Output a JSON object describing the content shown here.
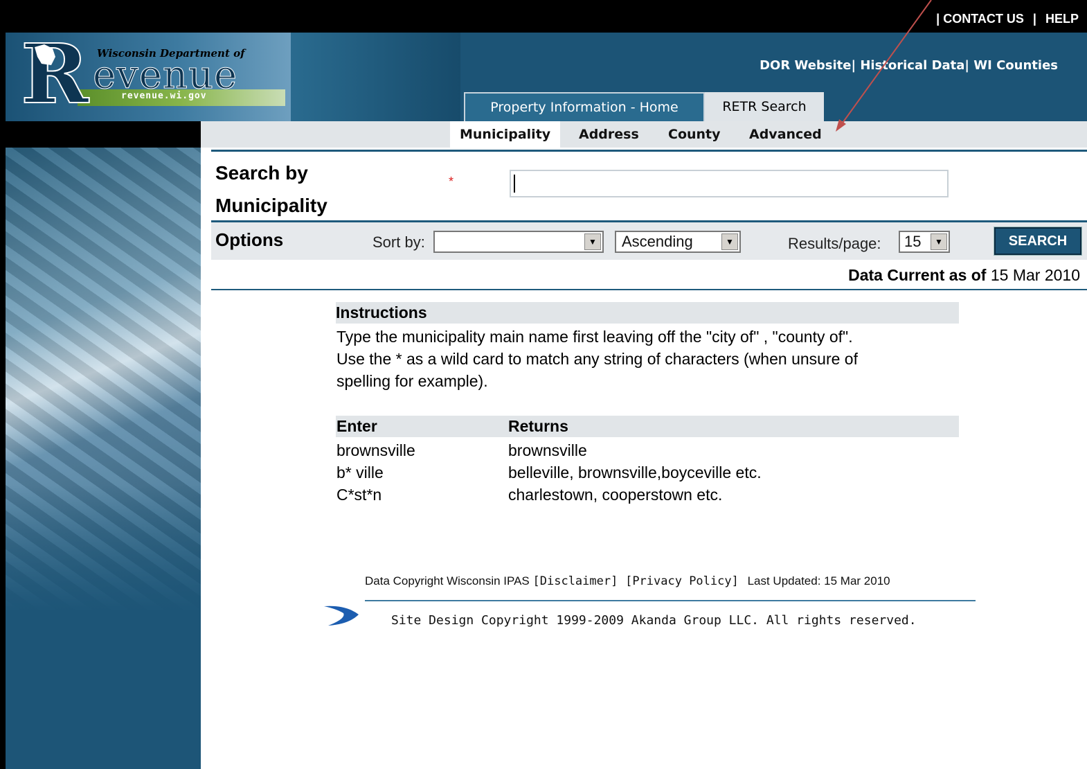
{
  "top_links": {
    "sep1": "|",
    "contact": "CONTACT US",
    "sep2": "|",
    "help": "HELP"
  },
  "logo": {
    "dept": "Wisconsin Department of",
    "letter": "R",
    "word": "evenue",
    "url": "revenue.wi.gov"
  },
  "header_links": {
    "dor": "DOR Website|",
    "historical": "Historical Data|",
    "counties": "WI Counties"
  },
  "tabs": {
    "home": "Property Information - Home",
    "retr": "RETR Search"
  },
  "subtabs": {
    "municipality": "Municipality",
    "address": "Address",
    "county": "County",
    "advanced": "Advanced"
  },
  "search": {
    "title_line1": "Search by",
    "title_line2": "Municipality",
    "required": "*",
    "value": ""
  },
  "options": {
    "label": "Options",
    "sort_label": "Sort by:",
    "sort_value": "",
    "order_value": "Ascending",
    "results_label": "Results/page:",
    "results_value": "15",
    "search_button": "SEARCH"
  },
  "data_current": {
    "label": "Data Current as of",
    "date": "15 Mar 2010"
  },
  "instructions": {
    "heading": "Instructions",
    "line1": "Type the municipality main name first leaving off the \"city of\" , \"county of\".",
    "line2": "Use the * as a wild card to match any string of characters (when unsure of",
    "line3": "spelling for example)."
  },
  "examples": {
    "col_enter": "Enter",
    "col_returns": "Returns",
    "rows": [
      {
        "enter": "brownsville",
        "returns": "brownsville"
      },
      {
        "enter": "b* ville",
        "returns": "belleville, brownsville,boyceville etc."
      },
      {
        "enter": "C*st*n",
        "returns": "charlestown, cooperstown etc."
      }
    ]
  },
  "footer": {
    "copyright": "Data Copyright Wisconsin IPAS",
    "disclaimer": "[Disclaimer]",
    "privacy": "[Privacy Policy]",
    "updated": "Last Updated: 15 Mar 2010",
    "site_design": "Site Design Copyright 1999-2009 Akanda Group LLC. All rights reserved."
  },
  "colors": {
    "header_blue": "#1c5476",
    "annotation_arrow": "#c0504d",
    "required_red": "#dd2222"
  }
}
